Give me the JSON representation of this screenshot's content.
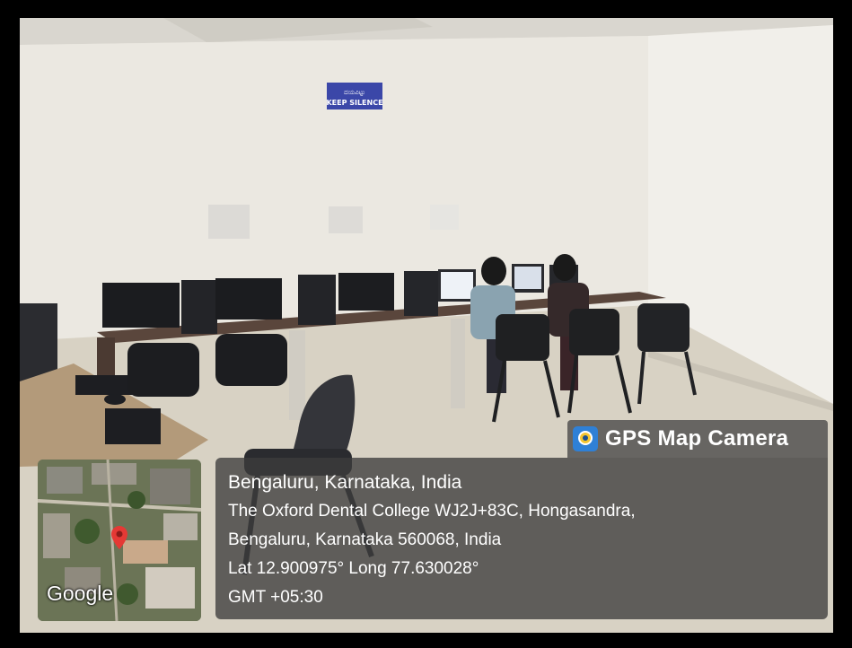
{
  "badge": {
    "title": "GPS Map Camera",
    "icon": "gps-map-camera-app-icon"
  },
  "sign": {
    "line1": "ದಯವಿಟ್ಟು",
    "line2": "KEEP SILENCE"
  },
  "location": {
    "city_line": "Bengaluru, Karnataka, India",
    "address_line1": "The Oxford Dental College WJ2J+83C, Hongasandra,",
    "address_line2": "Bengaluru, Karnataka 560068, India",
    "coordinates": "Lat 12.900975° Long 77.630028°",
    "timezone": "GMT +05:30"
  },
  "map": {
    "logo": "Google",
    "pin_color": "#e53935"
  },
  "colors": {
    "sign_blue": "#3b47a8",
    "overlay": "#3c3c3c"
  }
}
